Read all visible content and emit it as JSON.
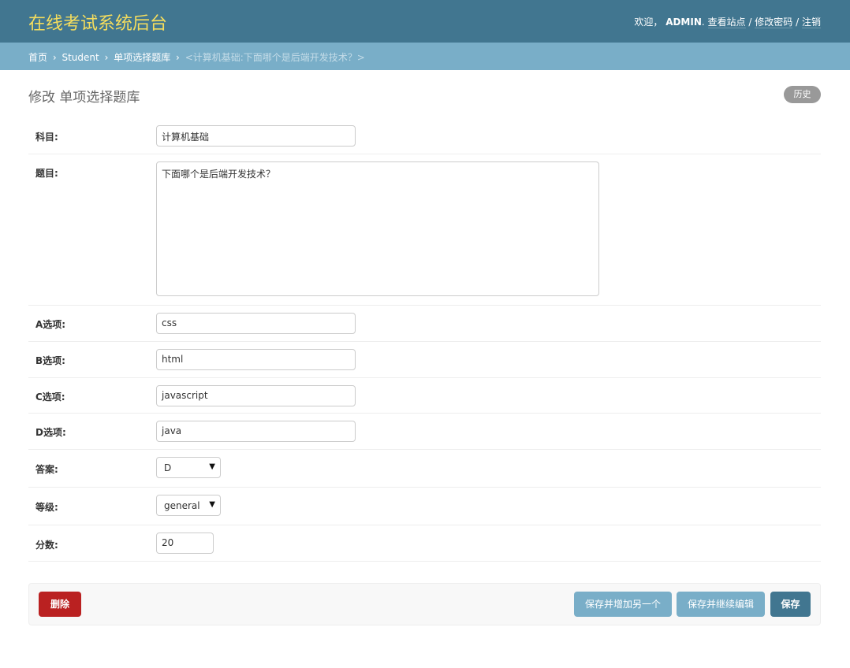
{
  "header": {
    "site_title": "在线考试系统后台",
    "welcome": "欢迎，",
    "username": "ADMIN",
    "after_username": ".",
    "view_site": "查看站点",
    "sep1": "/",
    "change_password": "修改密码",
    "sep2": "/",
    "logout": "注销"
  },
  "breadcrumbs": {
    "home": "首页",
    "sep": "›",
    "app": "Student",
    "model": "单项选择题库",
    "current": "<计算机基础:下面哪个是后端开发技术？>"
  },
  "page": {
    "title": "修改 单项选择题库",
    "history": "历史"
  },
  "form": {
    "subject": {
      "label": "科目:",
      "value": "计算机基础"
    },
    "question": {
      "label": "题目:",
      "value": "下面哪个是后端开发技术？"
    },
    "option_a": {
      "label": "A选项:",
      "value": "css"
    },
    "option_b": {
      "label": "B选项:",
      "value": "html"
    },
    "option_c": {
      "label": "C选项:",
      "value": "javascript"
    },
    "option_d": {
      "label": "D选项:",
      "value": "java"
    },
    "answer": {
      "label": "答案:",
      "value": "D"
    },
    "level": {
      "label": "等级:",
      "value": "general"
    },
    "score": {
      "label": "分数:",
      "value": "20"
    }
  },
  "submit": {
    "delete": "删除",
    "save_add_another": "保存并增加另一个",
    "save_continue": "保存并继续编辑",
    "save": "保存"
  },
  "colors": {
    "header_bg": "#417690",
    "breadcrumb_bg": "#79aec8",
    "delete_bg": "#ba2121",
    "save_bg": "#417690",
    "secondary_btn_bg": "#79aec8"
  },
  "icons": {
    "select_caret": "caret-down-icon"
  }
}
